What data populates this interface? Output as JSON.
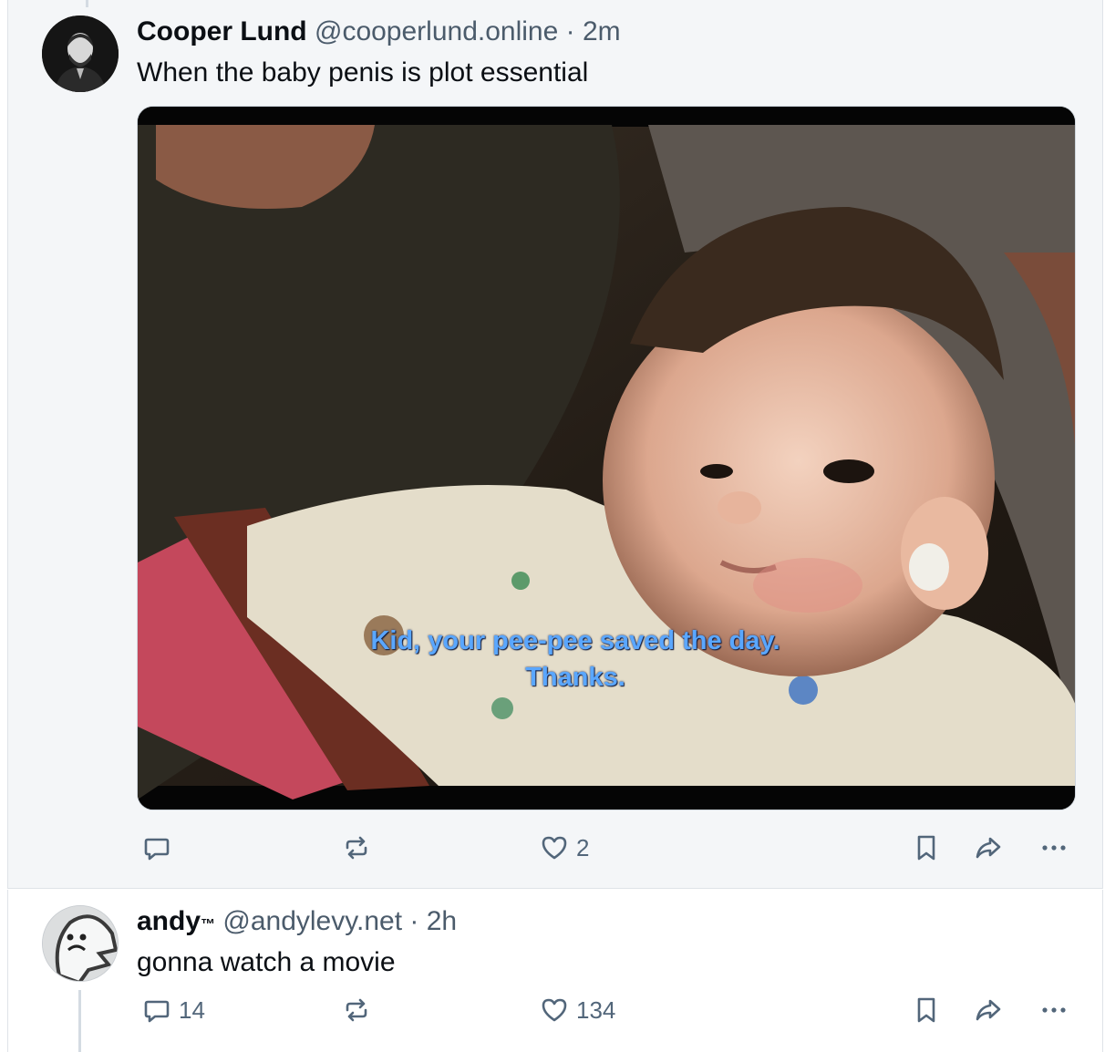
{
  "posts": [
    {
      "display_name": "Cooper Lund",
      "handle": "@cooperlund.online",
      "separator": "·",
      "time": "2m",
      "text": "When the baby penis is plot essential",
      "media": {
        "subtitle_line1": "Kid, your pee-pee saved the day.",
        "subtitle_line2": "Thanks."
      },
      "actions": {
        "reply_count": "",
        "repost_count": "",
        "like_count": "2"
      }
    },
    {
      "display_name": "andy",
      "display_name_suffix": "™",
      "handle": "@andylevy.net",
      "separator": "·",
      "time": "2h",
      "text": "gonna watch a movie",
      "actions": {
        "reply_count": "14",
        "repost_count": "",
        "like_count": "134"
      }
    }
  ],
  "icons": {
    "reply": "reply-icon",
    "repost": "repost-icon",
    "like": "heart-icon",
    "bookmark": "bookmark-icon",
    "share": "share-icon",
    "more": "more-icon"
  },
  "colors": {
    "highlight_bg": "#f4f6f8",
    "muted_text": "#4b5b6b",
    "icon": "#52667a",
    "subtitle": "#5aa7ff"
  }
}
